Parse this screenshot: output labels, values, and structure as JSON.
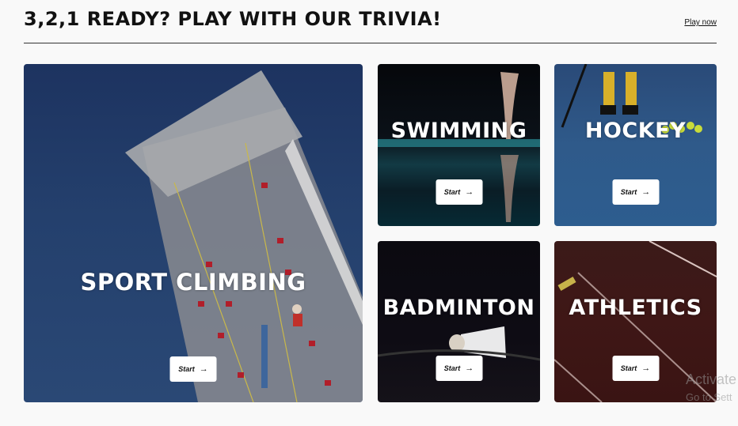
{
  "header": {
    "title": "3,2,1 READY? PLAY WITH OUR TRIVIA!",
    "play_now": "Play now"
  },
  "cards": [
    {
      "title": "SPORT CLIMBING",
      "start_label": "Start",
      "arrow_icon": "arrow-right-icon"
    },
    {
      "title": "SWIMMING",
      "start_label": "Start",
      "arrow_icon": "arrow-right-icon"
    },
    {
      "title": "HOCKEY",
      "start_label": "Start",
      "arrow_icon": "arrow-right-icon"
    },
    {
      "title": "BADMINTON",
      "start_label": "Start",
      "arrow_icon": "arrow-right-icon"
    },
    {
      "title": "ATHLETICS",
      "start_label": "Start",
      "arrow_icon": "arrow-right-icon"
    }
  ],
  "windows_watermark": {
    "line1": "Activate",
    "line2": "Go to Sett"
  },
  "colors": {
    "page_background": "#f9f9f9",
    "button_background": "#ffffff",
    "title_text": "#ffffff"
  }
}
